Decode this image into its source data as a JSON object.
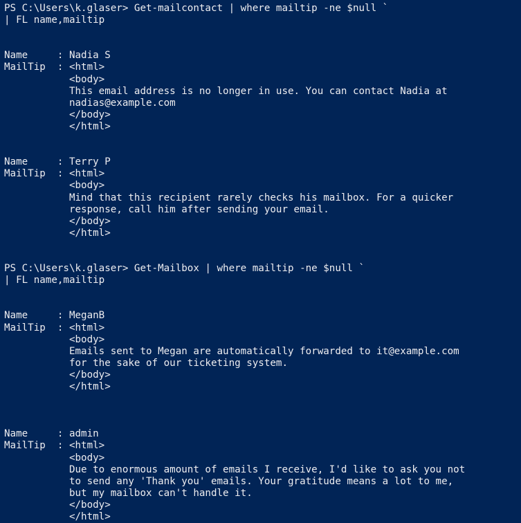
{
  "terminal": {
    "app": "Windows PowerShell",
    "background_color": "#012456",
    "foreground_color": "#eeedf0",
    "prompt_path": "PS C:\\Users\\k.glaser>",
    "columns": 78,
    "lines": [
      {
        "type": "prompt",
        "text": "PS C:\\Users\\k.glaser> Get-mailcontact | where mailtip -ne $null `"
      },
      {
        "type": "prompt-continuation",
        "text": "| FL name,mailtip"
      },
      {
        "type": "blank",
        "text": ""
      },
      {
        "type": "blank",
        "text": ""
      },
      {
        "type": "output",
        "text": "Name     : Nadia S"
      },
      {
        "type": "output",
        "text": "MailTip  : <html>"
      },
      {
        "type": "output",
        "text": "           <body>"
      },
      {
        "type": "output",
        "text": "           This email address is no longer in use. You can contact Nadia at"
      },
      {
        "type": "output",
        "text": "           nadias@example.com"
      },
      {
        "type": "output",
        "text": "           </body>"
      },
      {
        "type": "output",
        "text": "           </html>"
      },
      {
        "type": "blank",
        "text": ""
      },
      {
        "type": "blank",
        "text": ""
      },
      {
        "type": "output",
        "text": "Name     : Terry P"
      },
      {
        "type": "output",
        "text": "MailTip  : <html>"
      },
      {
        "type": "output",
        "text": "           <body>"
      },
      {
        "type": "output",
        "text": "           Mind that this recipient rarely checks his mailbox. For a quicker"
      },
      {
        "type": "output",
        "text": "           response, call him after sending your email."
      },
      {
        "type": "output",
        "text": "           </body>"
      },
      {
        "type": "output",
        "text": "           </html>"
      },
      {
        "type": "blank",
        "text": ""
      },
      {
        "type": "blank",
        "text": ""
      },
      {
        "type": "prompt",
        "text": "PS C:\\Users\\k.glaser> Get-Mailbox | where mailtip -ne $null `"
      },
      {
        "type": "prompt-continuation",
        "text": "| FL name,mailtip"
      },
      {
        "type": "blank",
        "text": ""
      },
      {
        "type": "blank",
        "text": ""
      },
      {
        "type": "output",
        "text": "Name     : MeganB"
      },
      {
        "type": "output",
        "text": "MailTip  : <html>"
      },
      {
        "type": "output",
        "text": "           <body>"
      },
      {
        "type": "output",
        "text": "           Emails sent to Megan are automatically forwarded to it@example.com"
      },
      {
        "type": "output",
        "text": "           for the sake of our ticketing system."
      },
      {
        "type": "output",
        "text": "           </body>"
      },
      {
        "type": "output",
        "text": "           </html>"
      },
      {
        "type": "blank",
        "text": ""
      },
      {
        "type": "blank",
        "text": ""
      },
      {
        "type": "blank",
        "text": ""
      },
      {
        "type": "output",
        "text": "Name     : admin"
      },
      {
        "type": "output",
        "text": "MailTip  : <html>"
      },
      {
        "type": "output",
        "text": "           <body>"
      },
      {
        "type": "output",
        "text": "           Due to enormous amount of emails I receive, I'd like to ask you not"
      },
      {
        "type": "output",
        "text": "           to send any 'Thank you' emails. Your gratitude means a lot to me,"
      },
      {
        "type": "output",
        "text": "           but my mailbox can't handle it."
      },
      {
        "type": "output",
        "text": "           </body>"
      },
      {
        "type": "output",
        "text": "           </html>"
      }
    ],
    "commands": [
      {
        "prompt": "PS C:\\Users\\k.glaser>",
        "command": "Get-mailcontact | where mailtip -ne $null `",
        "continuation": "| FL name,mailtip"
      },
      {
        "prompt": "PS C:\\Users\\k.glaser>",
        "command": "Get-Mailbox | where mailtip -ne $null `",
        "continuation": "| FL name,mailtip"
      }
    ],
    "records": [
      {
        "Name": "Nadia S",
        "MailTip": "<html>\n<body>\nThis email address is no longer in use. You can contact Nadia at nadias@example.com\n</body>\n</html>"
      },
      {
        "Name": "Terry P",
        "MailTip": "<html>\n<body>\nMind that this recipient rarely checks his mailbox. For a quicker response, call him after sending your email.\n</body>\n</html>"
      },
      {
        "Name": "MeganB",
        "MailTip": "<html>\n<body>\nEmails sent to Megan are automatically forwarded to it@example.com for the sake of our ticketing system.\n</body>\n</html>"
      },
      {
        "Name": "admin",
        "MailTip": "<html>\n<body>\nDue to enormous amount of emails I receive, I'd like to ask you not to send any 'Thank you' emails. Your gratitude means a lot to me, but my mailbox can't handle it.\n</body>\n</html>"
      }
    ]
  }
}
